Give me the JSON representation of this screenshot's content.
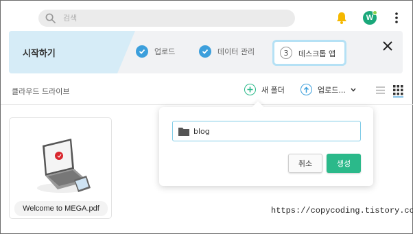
{
  "search": {
    "placeholder": "검색",
    "icon": "search-icon"
  },
  "header": {
    "avatar_letter": "W",
    "bell_color": "#f5b800",
    "avatar_color": "#1aa87a"
  },
  "banner": {
    "start_label": "시작하기",
    "steps": [
      {
        "label": "업로드",
        "done": true
      },
      {
        "label": "데이터 관리",
        "done": true
      },
      {
        "label": "데스크톱 앱",
        "number": "3",
        "done": false
      }
    ]
  },
  "toolbar": {
    "breadcrumb": "클라우드 드라이브",
    "new_folder_label": "새 폴더",
    "upload_label": "업로드...",
    "accent": "#2bb98a"
  },
  "files": [
    {
      "name": "Welcome to MEGA.pdf"
    }
  ],
  "dialog": {
    "input_value": "blog",
    "cancel_label": "취소",
    "create_label": "생성"
  },
  "watermark": "https://copycoding.tistory.com/"
}
